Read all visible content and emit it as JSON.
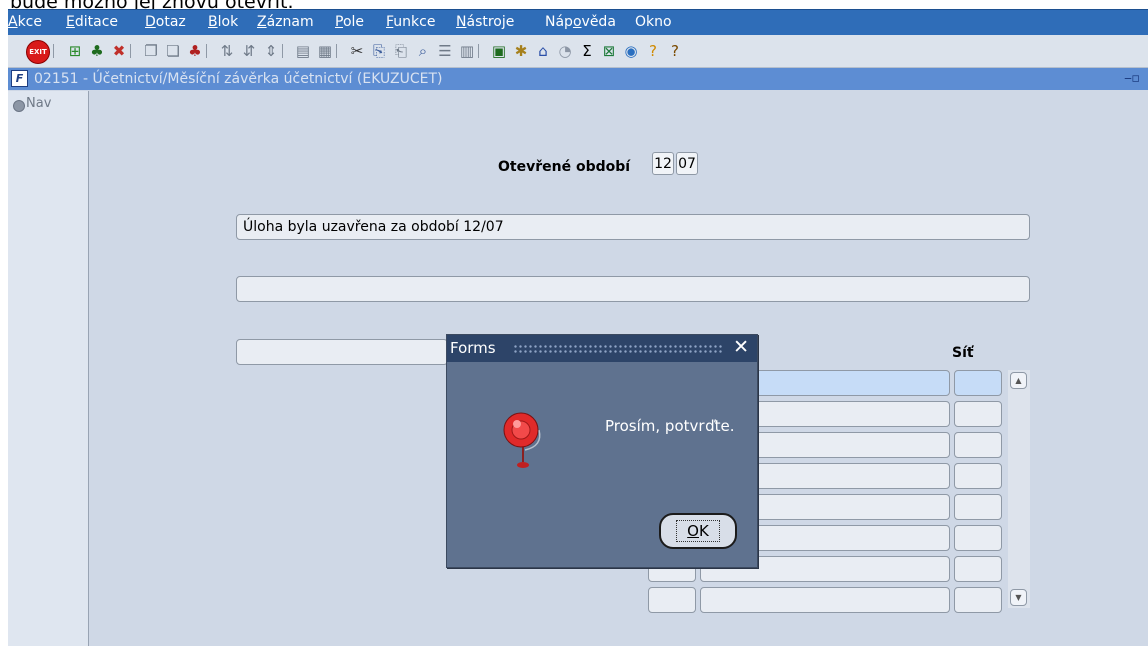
{
  "top_text": "bude možno jej znovu otevřít.",
  "menu": [
    {
      "pre": "",
      "u": "A",
      "post": "kce"
    },
    {
      "pre": "",
      "u": "E",
      "post": "ditace"
    },
    {
      "pre": "",
      "u": "D",
      "post": "otaz"
    },
    {
      "pre": "",
      "u": "B",
      "post": "lok"
    },
    {
      "pre": "",
      "u": "Z",
      "post": "áznam"
    },
    {
      "pre": "",
      "u": "P",
      "post": "ole"
    },
    {
      "pre": "",
      "u": "F",
      "post": "unkce"
    },
    {
      "pre": "",
      "u": "N",
      "post": "ástroje"
    },
    {
      "pre": "Náp",
      "u": "o",
      "post": "věda"
    },
    {
      "pre": "",
      "u": "",
      "post": "Okno"
    }
  ],
  "toolbar": {
    "exit_label": "EXIT",
    "icons": [
      {
        "name": "insert-record-icon",
        "glyph": "⊞",
        "color": "#2a8a2a"
      },
      {
        "name": "add-record-icon",
        "glyph": "♣",
        "color": "#1e6b1e"
      },
      {
        "name": "delete-record-icon",
        "glyph": "✖",
        "color": "#c0302a"
      },
      {
        "name": "copy-record-icon",
        "glyph": "❐",
        "color": "#6f7a88"
      },
      {
        "name": "paste-record-icon",
        "glyph": "❏",
        "color": "#6f7a88"
      },
      {
        "name": "remove-record-icon",
        "glyph": "♣",
        "color": "#b02020"
      },
      {
        "name": "sort-asc-icon",
        "glyph": "⇅",
        "color": "#6f7a88"
      },
      {
        "name": "sort-desc-icon",
        "glyph": "⇵",
        "color": "#6f7a88"
      },
      {
        "name": "sort-multi-icon",
        "glyph": "⇕",
        "color": "#6f7a88"
      },
      {
        "name": "print-icon",
        "glyph": "▤",
        "color": "#6f7a88"
      },
      {
        "name": "print-preview-icon",
        "glyph": "▦",
        "color": "#6f7a88"
      },
      {
        "name": "cut-icon",
        "glyph": "✂",
        "color": "#333333"
      },
      {
        "name": "copy-icon",
        "glyph": "⎘",
        "color": "#3d5e9c"
      },
      {
        "name": "paste-icon",
        "glyph": "⎗",
        "color": "#6f7a88"
      },
      {
        "name": "find-icon",
        "glyph": "⌕",
        "color": "#3d5e9c"
      },
      {
        "name": "list-icon",
        "glyph": "☰",
        "color": "#6f7a88"
      },
      {
        "name": "columns-icon",
        "glyph": "▥",
        "color": "#6f7a88"
      },
      {
        "name": "export-icon",
        "glyph": "▣",
        "color": "#1e6b1e"
      },
      {
        "name": "tools-icon",
        "glyph": "✱",
        "color": "#a6801c"
      },
      {
        "name": "home-icon",
        "glyph": "⌂",
        "color": "#2a4fa8"
      },
      {
        "name": "clock-icon",
        "glyph": "◔",
        "color": "#8c96a5"
      },
      {
        "name": "sum-icon",
        "glyph": "Σ",
        "color": "#000000"
      },
      {
        "name": "excel-icon",
        "glyph": "⊠",
        "color": "#1e7a3a"
      },
      {
        "name": "browser-icon",
        "glyph": "◉",
        "color": "#2a6fc0"
      },
      {
        "name": "help-icon",
        "glyph": "?",
        "color": "#d08a00"
      },
      {
        "name": "context-help-icon",
        "glyph": "?",
        "color": "#7a4a00"
      }
    ]
  },
  "title_bar": {
    "icon_letter": "F",
    "text": "02151 - Účetnictví/Měsíční závěrka účetnictví (EKUZUCET)"
  },
  "nav": {
    "label": "Nav"
  },
  "form": {
    "period_label": "Otevřené období",
    "period_month": "12",
    "period_year": "07",
    "field1": "Úloha byla uzavřena za období 12/07",
    "field2": "",
    "sit_header": "Síť"
  },
  "dialog": {
    "title": "Forms",
    "message": "Prosím, potvrďte.",
    "ok_label": "OK",
    "ok_underline": "O"
  },
  "colors": {
    "menubar": "#2f6db8",
    "titlebar": "#5d8dd3",
    "form_bg": "#cfd8e6",
    "dialog_bg": "#5f728f",
    "selected_cell": "#c6dcf7"
  }
}
